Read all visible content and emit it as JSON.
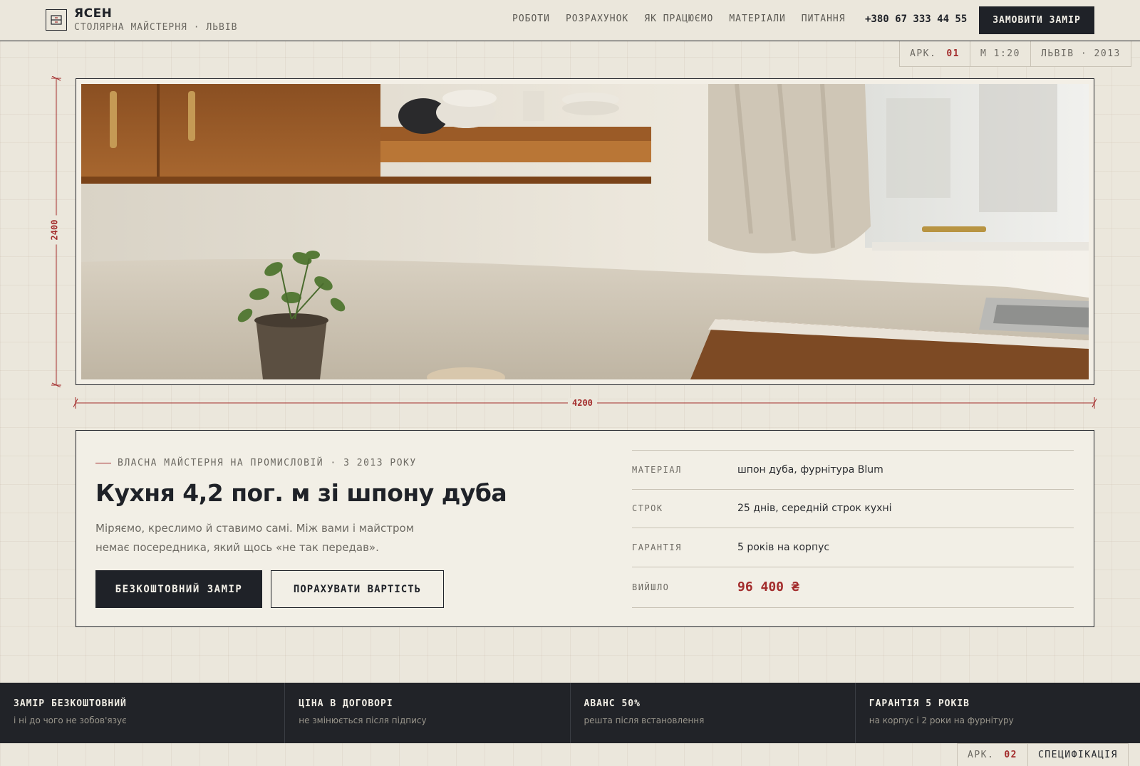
{
  "header": {
    "brand_name": "ЯСЕН",
    "brand_sub": "СТОЛЯРНА МАЙСТЕРНЯ · ЛЬВІВ",
    "logo_icon": "cabinet-icon",
    "nav": [
      "РОБОТИ",
      "РОЗРАХУНОК",
      "ЯК ПРАЦЮЄМО",
      "МАТЕРІАЛИ",
      "ПИТАННЯ"
    ],
    "phone": "+380 67 333 44 55",
    "order_button": "ЗАМОВИТИ ЗАМІР"
  },
  "stamp_top": {
    "sheet_label": "АРК.",
    "sheet_number": "01",
    "scale": "М 1:20",
    "place_year": "ЛЬВІВ · 2013"
  },
  "hero": {
    "image_icon": "kitchen-photo",
    "dimension_height": "2400",
    "dimension_width": "4200"
  },
  "card": {
    "eyebrow": "ВЛАСНА МАЙСТЕРНЯ НА ПРОМИСЛОВІЙ · З 2013 РОКУ",
    "title": "Кухня 4,2 пог. м зі шпону дуба",
    "description": "Міряємо, креслимо й ставимо самі. Між вами і майстром немає посередника, який щось «не так передав».",
    "primary_button": "БЕЗКОШТОВНИЙ ЗАМІР",
    "secondary_button": "ПОРАХУВАТИ ВАРТІСТЬ",
    "specs": [
      {
        "key": "МАТЕРІАЛ",
        "value": "шпон дуба, фурнітура Blum"
      },
      {
        "key": "СТРОК",
        "value": "25 днів, середній строк кухні"
      },
      {
        "key": "ГАРАНТІЯ",
        "value": "5 років на корпус"
      },
      {
        "key": "ВИЙШЛО",
        "value": "96 400 ₴"
      }
    ]
  },
  "strip": [
    {
      "title": "ЗАМІР БЕЗКОШТОВНИЙ",
      "sub": "і ні до чого не зобов'язує"
    },
    {
      "title": "ЦІНА В ДОГОВОРІ",
      "sub": "не змінюється після підпису"
    },
    {
      "title": "АВАНС 50%",
      "sub": "решта після встановлення"
    },
    {
      "title": "ГАРАНТІЯ 5 РОКІВ",
      "sub": "на корпус і 2 роки на фурнітуру"
    }
  ],
  "stamp_bottom": {
    "sheet_label": "АРК.",
    "sheet_number": "02",
    "section": "СПЕЦИФІКАЦІЯ"
  },
  "colors": {
    "accent": "#a32c2c",
    "ink": "#1f2228",
    "paper": "#ebe7dc",
    "card": "#f2efe6"
  }
}
